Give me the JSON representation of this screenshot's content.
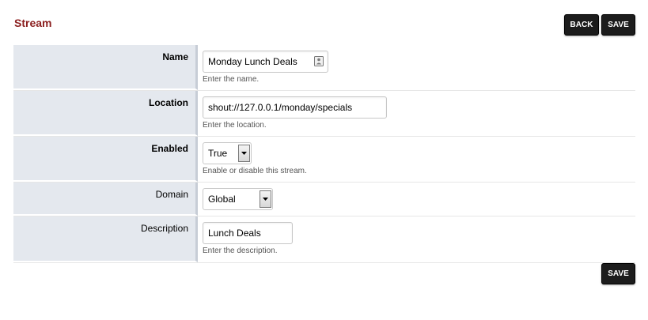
{
  "header": {
    "title": "Stream",
    "back_label": "BACK",
    "save_label": "SAVE"
  },
  "form": {
    "name": {
      "label": "Name",
      "value": "Monday Lunch Deals",
      "hint": "Enter the name."
    },
    "location": {
      "label": "Location",
      "value": "shout://127.0.0.1/monday/specials",
      "hint": "Enter the location."
    },
    "enabled": {
      "label": "Enabled",
      "value": "True",
      "hint": "Enable or disable this stream."
    },
    "domain": {
      "label": "Domain",
      "value": "Global"
    },
    "description": {
      "label": "Description",
      "value": "Lunch Deals",
      "hint": "Enter the description."
    }
  },
  "footer": {
    "save_label": "SAVE"
  }
}
